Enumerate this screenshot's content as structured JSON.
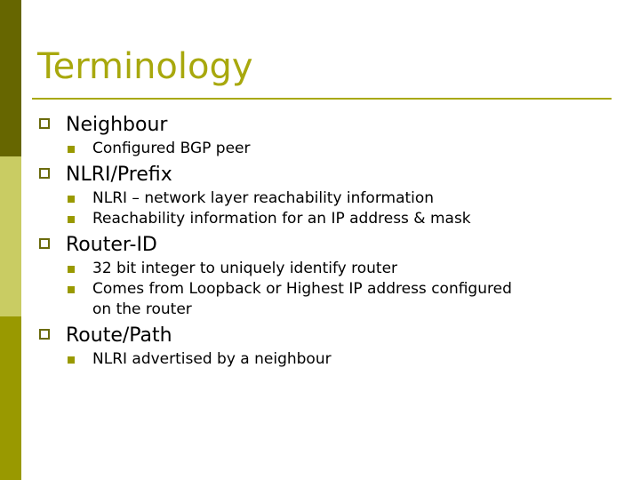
{
  "slide": {
    "title": "Terminology",
    "theme": {
      "title_color": "#a8a80d",
      "rule_color": "#a8a80d",
      "band_top_color": "#666600",
      "band_middle_color": "#c9cc63",
      "band_bottom_color": "#999900",
      "level1_marker_color": "#6b6b0d",
      "level2_marker_color": "#999900",
      "body_text_color": "#000000",
      "background_color": "#ffffff"
    },
    "groups": [
      {
        "heading": "Neighbour",
        "items": [
          {
            "text": "Configured BGP peer",
            "cont": ""
          }
        ]
      },
      {
        "heading": "NLRI/Prefix",
        "items": [
          {
            "text": "NLRI – network layer reachability information",
            "cont": ""
          },
          {
            "text": "Reachability information for an IP address & mask",
            "cont": ""
          }
        ]
      },
      {
        "heading": "Router-ID",
        "items": [
          {
            "text": "32 bit integer to uniquely identify router",
            "cont": ""
          },
          {
            "text": "Comes from Loopback or Highest IP address configured",
            "cont": "on the router"
          }
        ]
      },
      {
        "heading": "Route/Path",
        "items": [
          {
            "text": "NLRI advertised by a neighbour",
            "cont": ""
          }
        ]
      }
    ]
  }
}
